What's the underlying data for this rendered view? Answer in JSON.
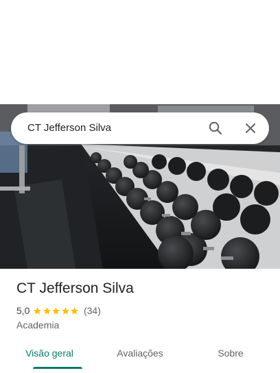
{
  "search": {
    "query": "CT Jefferson Silva"
  },
  "photo": {
    "subject": "dumbbell rack"
  },
  "place": {
    "name": "CT Jefferson Silva",
    "rating": "5,0",
    "stars": 5,
    "review_count": "(34)",
    "category": "Academia"
  },
  "tabs": [
    {
      "label": "Visão geral",
      "active": true
    },
    {
      "label": "Avaliações",
      "active": false
    },
    {
      "label": "Sobre",
      "active": false
    }
  ],
  "colors": {
    "accent": "#0b7a70",
    "star": "#fbbc04",
    "text_primary": "#202124",
    "text_secondary": "#5f6368"
  },
  "icons": [
    "search-icon",
    "close-icon",
    "star-icon"
  ]
}
